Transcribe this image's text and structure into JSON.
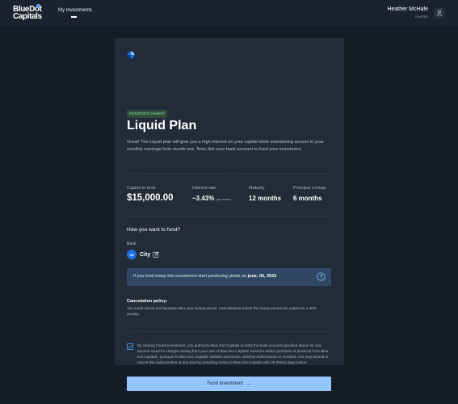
{
  "header": {
    "logo_line1": "BlueDot",
    "logo_line2": "Capitals",
    "nav": {
      "my_investments": "My Investments"
    },
    "user": {
      "name": "Heather McHale",
      "role": "Investor"
    }
  },
  "card": {
    "badge": "Investment created!",
    "title": "Liquid Plan",
    "description": "Great! The Liquid plan will give you a high interest on your capital while maintaining access to your monthly earnings from month one. Now, link your bank account to fund your investment.",
    "stats": {
      "capital_label": "Capital to fund",
      "capital_value": "$15,000.00",
      "rate_label": "Interest rate",
      "rate_value": "~3.43%",
      "rate_unit": "per month",
      "maturity_label": "Maturity",
      "maturity_value": "12 months",
      "lockup_label": "Principal Lockup",
      "lockup_value": "6 months"
    },
    "fund_question": "How you want to fund?",
    "bank_label": "Bank",
    "bank_logo_text": "cb",
    "bank_name": "City",
    "info_prefix": "If you fund today this investment start producing yields on ",
    "info_date": "june, 06, 2022",
    "cancel_title": "Cancelation policy:",
    "cancel_text": "You could cancel and liquidate after your lockup period. Cancellations before the lockup period are subject to a 30% penalty.",
    "consent_checked": true,
    "consent_text": "By clicking Found investment, you authorize Blue Dot Capitals to debit the bank account specified above for any amount owed for charges arising from your use of Blue Dot Capitals' services and/or purchase of products from Blue Dot Capitals, pursuant to Blue Dot Capitals' website and terms, until this authorization is revoked. You may amend or cancel this authorization at any time by providing notice to Blue Dot Capitals with 30 (thirty) days notice.",
    "fund_button": "Fund investment",
    "fund_button_arrow": "→"
  },
  "icons": {
    "brand": "brand-logo-icon",
    "user": "user-icon",
    "edit": "edit-icon",
    "help": "question-circle-icon",
    "check": "checkmark-icon"
  },
  "colors": {
    "background": "#151c26",
    "card": "#222b37",
    "accent_button": "#94c5fb",
    "info_box": "#2f4763",
    "badge_bg": "#2f4a38",
    "badge_text": "#7bd8a0"
  }
}
